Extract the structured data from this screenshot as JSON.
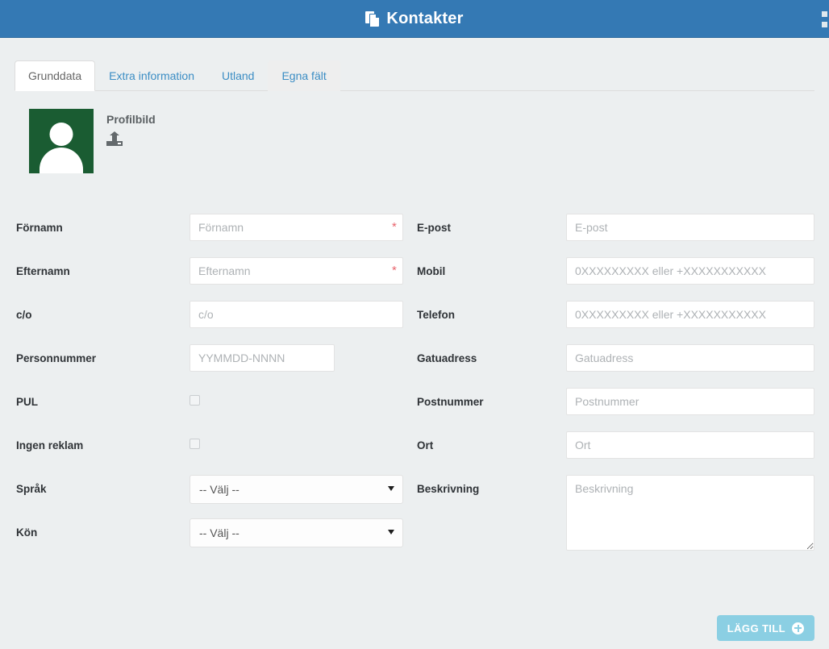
{
  "window": {
    "title": "Kontakter",
    "title_icon": "copy-files-icon",
    "header_color": "#3479b4"
  },
  "tabs": [
    {
      "label": "Grunddata",
      "state": "active"
    },
    {
      "label": "Extra information",
      "state": "default"
    },
    {
      "label": "Utland",
      "state": "default"
    },
    {
      "label": "Egna fält",
      "state": "hover"
    }
  ],
  "profile": {
    "label": "Profilbild",
    "avatar_icon": "person-placeholder-icon",
    "avatar_color": "#1a5c32",
    "upload_icon": "upload-icon"
  },
  "form": {
    "left_fields": [
      {
        "label": "Förnamn",
        "type": "text",
        "value": "",
        "placeholder": "Förnamn",
        "required": true,
        "width": "normal"
      },
      {
        "label": "Efternamn",
        "type": "text",
        "value": "",
        "placeholder": "Efternamn",
        "required": true,
        "width": "normal"
      },
      {
        "label": "c/o",
        "type": "text",
        "value": "",
        "placeholder": "c/o",
        "required": false,
        "width": "normal"
      },
      {
        "label": "Personnummer",
        "type": "text",
        "value": "",
        "placeholder": "YYMMDD-NNNN",
        "required": false,
        "width": "narrow"
      },
      {
        "label": "PUL",
        "type": "checkbox",
        "checked": false
      },
      {
        "label": "Ingen reklam",
        "type": "checkbox",
        "checked": false
      },
      {
        "label": "Språk",
        "type": "select",
        "value": "-- Välj --"
      },
      {
        "label": "Kön",
        "type": "select",
        "value": "-- Välj --"
      }
    ],
    "right_fields": [
      {
        "label": "E-post",
        "type": "text",
        "value": "",
        "placeholder": "E-post"
      },
      {
        "label": "Mobil",
        "type": "text",
        "value": "",
        "placeholder": "0XXXXXXXXX eller +XXXXXXXXXXX"
      },
      {
        "label": "Telefon",
        "type": "text",
        "value": "",
        "placeholder": "0XXXXXXXXX eller +XXXXXXXXXXX"
      },
      {
        "label": "Gatuadress",
        "type": "text",
        "value": "",
        "placeholder": "Gatuadress"
      },
      {
        "label": "Postnummer",
        "type": "text",
        "value": "",
        "placeholder": "Postnummer"
      },
      {
        "label": "Ort",
        "type": "text",
        "value": "",
        "placeholder": "Ort"
      },
      {
        "label": "Beskrivning",
        "type": "textarea",
        "value": "",
        "placeholder": "Beskrivning"
      }
    ],
    "select_options": [
      "-- Välj --"
    ],
    "required_marker": "*",
    "required_marker_color": "#e8646d"
  },
  "footer": {
    "submit_label": "LÄGG TILL",
    "submit_icon": "plus-circle-icon",
    "submit_color": "#8bcfe3"
  }
}
